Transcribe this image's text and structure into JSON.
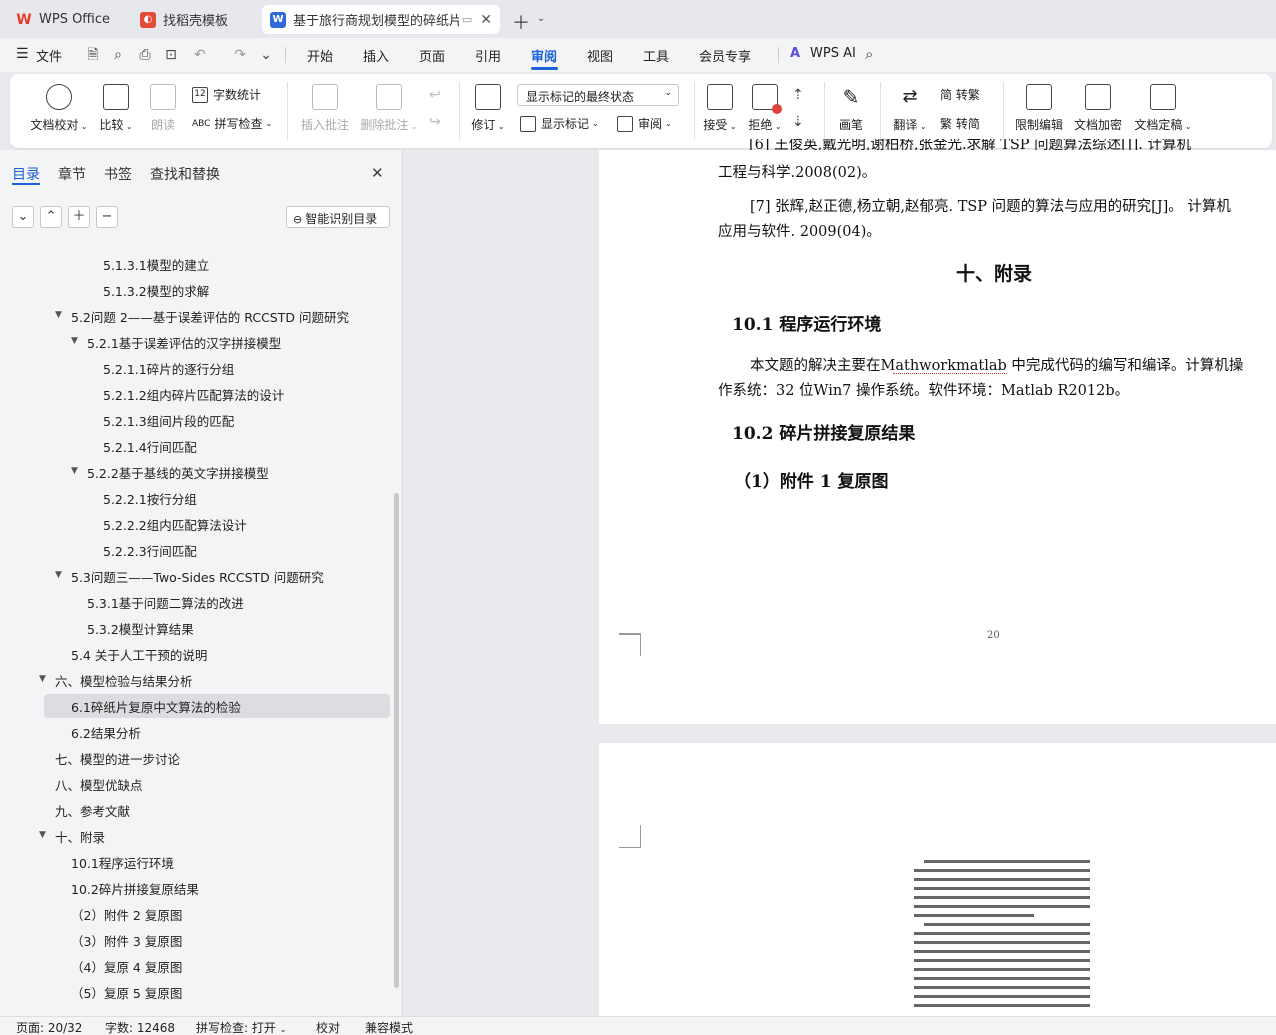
{
  "tabs": [
    {
      "label": "WPS Office"
    },
    {
      "label": "找稻壳模板"
    },
    {
      "label": "基于旅行商规划模型的碎纸片"
    }
  ],
  "menu": {
    "file": "文件",
    "items": [
      "开始",
      "插入",
      "页面",
      "引用",
      "审阅",
      "视图",
      "工具",
      "会员专享"
    ],
    "ai": "WPS AI",
    "active": "审阅"
  },
  "ribbon": {
    "proofread": "文档校对",
    "compare": "比较",
    "read_aloud": "朗读",
    "word_count": "字数统计",
    "spell_check": "拼写检查",
    "insert_comment": "插入批注",
    "delete_comment": "删除批注",
    "revise": "修订",
    "markup_state": "显示标记的最终状态",
    "show_markup": "显示标记",
    "review": "审阅",
    "accept": "接受",
    "reject": "拒绝",
    "pen": "画笔",
    "translate": "翻译",
    "trad_conv": "简 转繁",
    "simp_conv": "繁 转简",
    "restrict_edit": "限制编辑",
    "encrypt": "文档加密",
    "finalize": "文档定稿"
  },
  "side": {
    "tabs": [
      "目录",
      "章节",
      "书签",
      "查找和替换"
    ],
    "smart_toc": "智能识别目录",
    "toc": [
      {
        "label": "5.1.3.1模型的建立",
        "level": 3
      },
      {
        "label": "5.1.3.2模型的求解",
        "level": 3
      },
      {
        "label": "5.2问题 2——基于误差评估的 RCCSTD 问题研究",
        "level": 1,
        "arrow": true
      },
      {
        "label": "5.2.1基于误差评估的汉字拼接模型",
        "level": 2,
        "arrow": true
      },
      {
        "label": "5.2.1.1碎片的逐行分组",
        "level": 3
      },
      {
        "label": "5.2.1.2组内碎片匹配算法的设计",
        "level": 3
      },
      {
        "label": "5.2.1.3组间片段的匹配",
        "level": 3
      },
      {
        "label": "5.2.1.4行间匹配",
        "level": 3
      },
      {
        "label": "5.2.2基于基线的英文字拼接模型",
        "level": 2,
        "arrow": true
      },
      {
        "label": "5.2.2.1按行分组",
        "level": 3
      },
      {
        "label": "5.2.2.2组内匹配算法设计",
        "level": 3
      },
      {
        "label": "5.2.2.3行间匹配",
        "level": 3
      },
      {
        "label": "5.3问题三——Two-Sides RCCSTD 问题研究",
        "level": 1,
        "arrow": true
      },
      {
        "label": "5.3.1基于问题二算法的改进",
        "level": 2
      },
      {
        "label": "5.3.2模型计算结果",
        "level": 2
      },
      {
        "label": "5.4 关于人工干预的说明",
        "level": 1
      },
      {
        "label": "六、模型检验与结果分析",
        "level": 0,
        "arrow": true
      },
      {
        "label": "6.1碎纸片复原中文算法的检验",
        "level": 1,
        "selected": true
      },
      {
        "label": "6.2结果分析",
        "level": 1
      },
      {
        "label": "七、模型的进一步讨论",
        "level": 0
      },
      {
        "label": "八、模型优缺点",
        "level": 0
      },
      {
        "label": "九、参考文献",
        "level": 0
      },
      {
        "label": "十、附录",
        "level": 0,
        "arrow": true
      },
      {
        "label": "10.1程序运行环境",
        "level": 1
      },
      {
        "label": "10.2碎片拼接复原结果",
        "level": 1
      },
      {
        "label": "（2）附件 2 复原图",
        "level": 1
      },
      {
        "label": "（3）附件 3 复原图",
        "level": 1
      },
      {
        "label": "（4）复原 4 复原图",
        "level": 1
      },
      {
        "label": "（5）复原 5 复原图",
        "level": 1
      }
    ]
  },
  "doc": {
    "ref6_line2": "工程与科学.2008(02)。",
    "ref7_line1": "[7]  张辉,赵正德,杨立朝,赵郁亮. TSP 问题的算法与应用的研究[J]。 计算机",
    "ref7_line2": "应用与软件. 2009(04)。",
    "h_appendix": "十、附录",
    "h_101": "10.1  程序运行环境",
    "p_env1": "本文题的解决主要在Mathworkmatlab 中完成代码的编写和编译。计算机操",
    "p_env2": "作系统：32 位Win7 操作系统。软件环境：Matlab    R2012b。",
    "h_102": "10.2  碎片拼接复原结果",
    "h_att1": "（1）附件 1 复原图",
    "page_no": "20"
  },
  "status": {
    "page": "页面: 20/32",
    "words": "字数: 12468",
    "spell": "拼写检查: 打开",
    "proof": "校对",
    "compat": "兼容模式"
  }
}
